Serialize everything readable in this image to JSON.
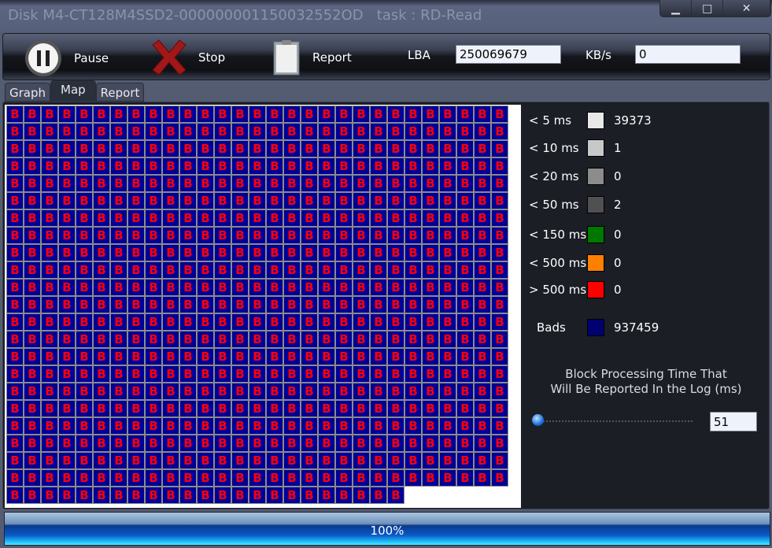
{
  "window": {
    "title": "Disk M4-CT128M4SSD2-000000001150032552OD   task : RD-Read",
    "minimize": "▁",
    "maximize": "□",
    "close": "✕"
  },
  "toolbar": {
    "pause_label": "Pause",
    "stop_label": "Stop",
    "report_label": "Report",
    "lba_label": "LBA",
    "lba_value": "250069679",
    "kbs_label": "KB/s",
    "kbs_value": "0"
  },
  "tabs": [
    {
      "label": "Graph"
    },
    {
      "label": "Map",
      "active": true
    },
    {
      "label": "Report"
    }
  ],
  "map": {
    "cell_label": "B",
    "cell_count": 661,
    "cell_color": "#000080"
  },
  "legend": [
    {
      "label": "< 5 ms",
      "color": "#e8e8e8",
      "value": "39373"
    },
    {
      "label": "< 10 ms",
      "color": "#c8c8c8",
      "value": "1"
    },
    {
      "label": "< 20 ms",
      "color": "#8c8c8c",
      "value": "0"
    },
    {
      "label": "< 50 ms",
      "color": "#505050",
      "value": "2"
    },
    {
      "label": "< 150 ms",
      "color": "#007800",
      "value": "0"
    },
    {
      "label": "< 500 ms",
      "color": "#ff8000",
      "value": "0"
    },
    {
      "label": "> 500 ms",
      "color": "#ff0000",
      "value": "0"
    },
    {
      "label": "Bads",
      "color": "#000070",
      "value": "937459"
    }
  ],
  "log_threshold": {
    "line1": "Block Processing Time That",
    "line2": "Will Be Reported In the Log (ms)",
    "value": "51",
    "slider_fraction": 0.0
  },
  "progress": {
    "label": "100%",
    "percent": 100
  }
}
